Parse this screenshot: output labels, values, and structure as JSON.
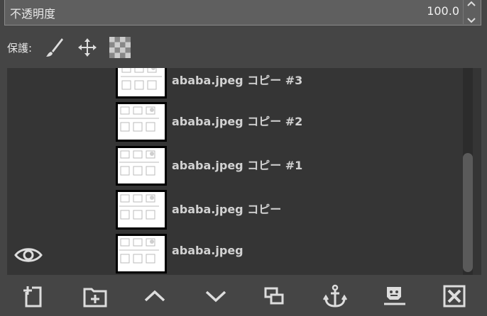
{
  "opacity": {
    "label": "不透明度",
    "value": "100.0"
  },
  "lock": {
    "label": "保護:",
    "icons": [
      "brush-lock-icon",
      "move-lock-icon",
      "alpha-lock-icon"
    ]
  },
  "layers": [
    {
      "name": "ababa.jpeg コピー #3",
      "visible": false
    },
    {
      "name": "ababa.jpeg コピー #2",
      "visible": false
    },
    {
      "name": "ababa.jpeg コピー #1",
      "visible": false
    },
    {
      "name": "ababa.jpeg コピー",
      "visible": false
    },
    {
      "name": "ababa.jpeg",
      "visible": true
    }
  ],
  "toolbar": {
    "buttons": [
      "new-layer",
      "new-layer-group",
      "raise-layer",
      "lower-layer",
      "duplicate-layer",
      "anchor-layer",
      "merge-down",
      "delete-layer"
    ]
  },
  "colors": {
    "panel_bg": "#454545",
    "list_bg": "#353535",
    "text": "#d2d2d2"
  }
}
